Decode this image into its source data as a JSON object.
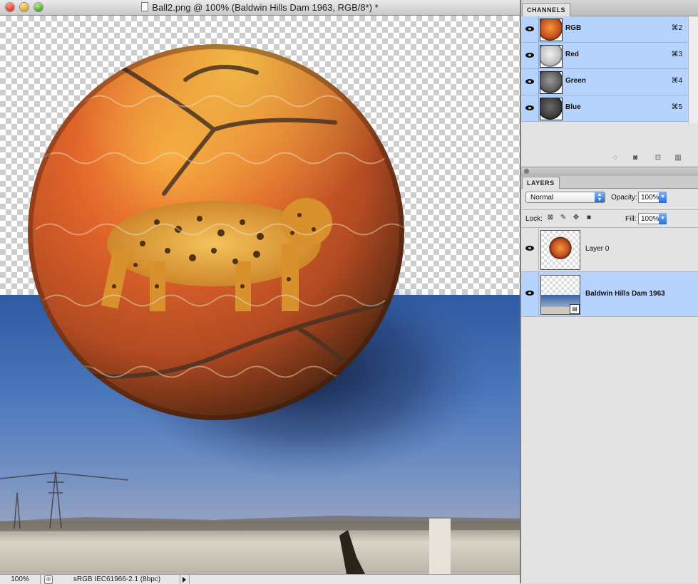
{
  "document": {
    "title": "Ball2.png @ 100% (Baldwin Hills Dam 1963, RGB/8*) *",
    "zoom": "100%",
    "color_profile": "sRGB IEC61966-2.1 (8bpc)"
  },
  "channels": {
    "tab": "CHANNELS",
    "items": [
      {
        "name": "RGB",
        "shortcut": "⌘2"
      },
      {
        "name": "Red",
        "shortcut": "⌘3"
      },
      {
        "name": "Green",
        "shortcut": "⌘4"
      },
      {
        "name": "Blue",
        "shortcut": "⌘5"
      }
    ]
  },
  "layers": {
    "tab": "LAYERS",
    "blend_mode": "Normal",
    "opacity_label": "Opacity:",
    "opacity": "100%",
    "lock_label": "Lock:",
    "fill_label": "Fill:",
    "fill": "100%",
    "items": [
      {
        "name": "Layer 0",
        "selected": false
      },
      {
        "name": "Baldwin Hills Dam 1963",
        "selected": true
      }
    ]
  },
  "colors": {
    "selection": "#b5d3fd",
    "panel_bg": "#e3e3e3",
    "sky": "#3a64a8"
  }
}
